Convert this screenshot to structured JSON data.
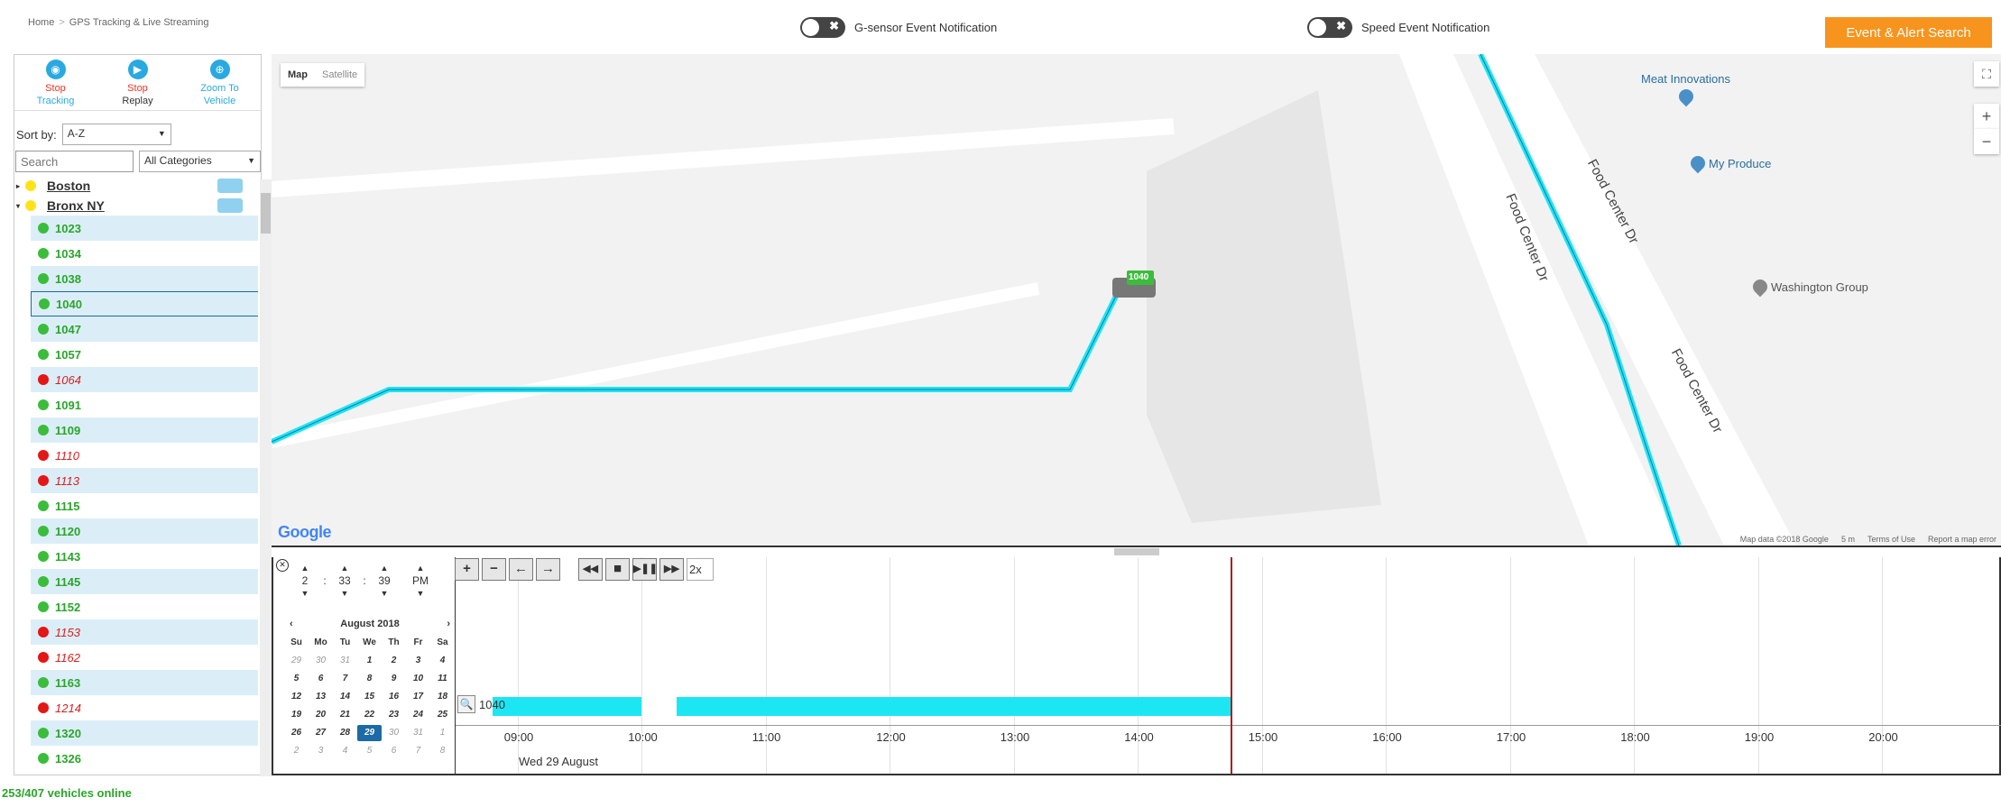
{
  "breadcrumb": {
    "home": "Home",
    "sep": ">",
    "current": "GPS Tracking & Live Streaming"
  },
  "toggles": {
    "gsensor": "G-sensor Event Notification",
    "speed": "Speed Event Notification"
  },
  "alert_button": "Event & Alert Search",
  "actions": {
    "stop_tracking": [
      "Stop",
      "Tracking"
    ],
    "stop_replay": [
      "Stop",
      "Replay"
    ],
    "zoom_vehicle": [
      "Zoom To",
      "Vehicle"
    ]
  },
  "sort": {
    "label": "Sort by:",
    "value": "A-Z"
  },
  "search": {
    "placeholder": "Search",
    "category": "All Categories"
  },
  "groups": [
    "Boston",
    "Bronx NY"
  ],
  "vehicles": [
    {
      "id": "1023",
      "online": true
    },
    {
      "id": "1034",
      "online": true
    },
    {
      "id": "1038",
      "online": true
    },
    {
      "id": "1040",
      "online": true,
      "selected": true
    },
    {
      "id": "1047",
      "online": true
    },
    {
      "id": "1057",
      "online": true
    },
    {
      "id": "1064",
      "online": false
    },
    {
      "id": "1091",
      "online": true
    },
    {
      "id": "1109",
      "online": true
    },
    {
      "id": "1110",
      "online": false
    },
    {
      "id": "1113",
      "online": false
    },
    {
      "id": "1115",
      "online": true
    },
    {
      "id": "1120",
      "online": true
    },
    {
      "id": "1143",
      "online": true
    },
    {
      "id": "1145",
      "online": true
    },
    {
      "id": "1152",
      "online": true
    },
    {
      "id": "1153",
      "online": false
    },
    {
      "id": "1162",
      "online": false
    },
    {
      "id": "1163",
      "online": true
    },
    {
      "id": "1214",
      "online": false
    },
    {
      "id": "1320",
      "online": true
    },
    {
      "id": "1326",
      "online": true
    }
  ],
  "online_count": "253/407 vehicles online",
  "map": {
    "type_map": "Map",
    "type_satellite": "Satellite",
    "zoom_in": "+",
    "zoom_out": "−",
    "vehicle_label": "1040",
    "pois": [
      "Meat Innovations",
      "My Produce",
      "Washington Group"
    ],
    "road": "Food Center Dr",
    "google": "Google",
    "attribution": [
      "Map data ©2018 Google",
      "5 m",
      "Terms of Use",
      "Report a map error"
    ]
  },
  "timepicker": {
    "hour": "2",
    "minute": "33",
    "second": "39",
    "ampm": "PM"
  },
  "calendar": {
    "title": "August 2018",
    "prev": "‹",
    "next": "›",
    "dow": [
      "Su",
      "Mo",
      "Tu",
      "We",
      "Th",
      "Fr",
      "Sa"
    ],
    "days": [
      [
        "29",
        "30",
        "31",
        "1",
        "2",
        "3",
        "4"
      ],
      [
        "5",
        "6",
        "7",
        "8",
        "9",
        "10",
        "11"
      ],
      [
        "12",
        "13",
        "14",
        "15",
        "16",
        "17",
        "18"
      ],
      [
        "19",
        "20",
        "21",
        "22",
        "23",
        "24",
        "25"
      ],
      [
        "26",
        "27",
        "28",
        "29",
        "30",
        "31",
        "1"
      ],
      [
        "2",
        "3",
        "4",
        "5",
        "6",
        "7",
        "8"
      ]
    ]
  },
  "timeline": {
    "speed": "2x",
    "row_label": "1040",
    "hours": [
      "09:00",
      "10:00",
      "11:00",
      "12:00",
      "13:00",
      "14:00",
      "15:00",
      "16:00",
      "17:00",
      "18:00",
      "19:00",
      "20:00"
    ],
    "date": "Wed 29 August",
    "segments": [
      [
        "08:48",
        "10:00"
      ],
      [
        "10:17",
        "14:45"
      ]
    ],
    "current_time": "14:45"
  },
  "colors": {
    "accent": "#f7941d",
    "track": "#1de6f3",
    "online": "#2aa52a",
    "offline": "#d91e1e",
    "selected": "#1c6aa6"
  }
}
